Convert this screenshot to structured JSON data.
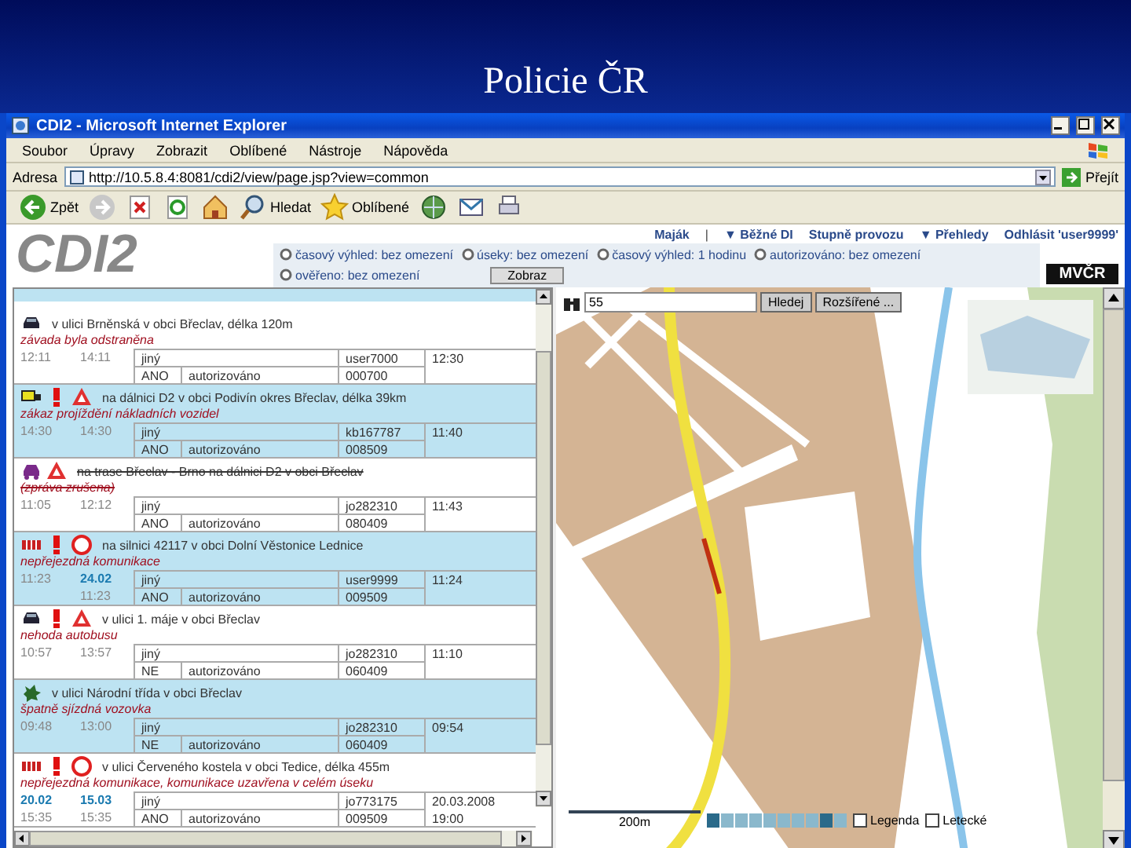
{
  "slide": {
    "title": "Policie ČR"
  },
  "window": {
    "title": "CDI2 - Microsoft Internet Explorer"
  },
  "menu": [
    "Soubor",
    "Úpravy",
    "Zobrazit",
    "Oblíbené",
    "Nástroje",
    "Nápověda"
  ],
  "address": {
    "label": "Adresa",
    "value": "http://10.5.8.4:8081/cdi2/view/page.jsp?view=common",
    "go": "Přejít"
  },
  "toolbar": [
    {
      "kind": "back",
      "label": "Zpět"
    },
    {
      "kind": "forward"
    },
    {
      "kind": "stop"
    },
    {
      "kind": "refresh"
    },
    {
      "kind": "home"
    },
    {
      "kind": "search",
      "label": "Hledat"
    },
    {
      "kind": "favorites",
      "label": "Oblíbené"
    },
    {
      "kind": "media"
    },
    {
      "kind": "mail"
    },
    {
      "kind": "print"
    }
  ],
  "app": {
    "logo": "CDI2",
    "nav": [
      {
        "kind": "link",
        "label": "Maják"
      },
      {
        "kind": "sep",
        "label": "|"
      },
      {
        "kind": "link",
        "label": "▼ Běžné DI"
      },
      {
        "kind": "link",
        "label": "Stupně provozu"
      },
      {
        "kind": "link",
        "label": "▼ Přehledy"
      },
      {
        "kind": "link",
        "label": "Odhlásit 'user9999'"
      }
    ],
    "filters": [
      {
        "label": "časový výhled: bez omezení"
      },
      {
        "label": "úseky: bez omezení"
      },
      {
        "label": "časový výhled: 1 hodinu"
      },
      {
        "label": "autorizováno: bez omezení"
      },
      {
        "label": "ověřeno: bez omezení"
      }
    ],
    "filter_button": "Zobraz",
    "badge": "MVČR"
  },
  "events": [
    {
      "icons": [
        {
          "kind": "car"
        }
      ],
      "location": "v ulici Brněnská v obci Břeclav, délka 120m",
      "note": "závada byla odstraněna",
      "cancelled": false,
      "start": {
        "time": "12:11"
      },
      "end": {
        "time": "14:11"
      },
      "type": "jiný",
      "author": "user7000",
      "reported": {
        "time": "12:30"
      },
      "verified": "ANO",
      "status": "autorizováno",
      "code": "000700"
    },
    {
      "icons": [
        {
          "kind": "truck"
        },
        {
          "kind": "exclamation"
        },
        {
          "kind": "triangle"
        }
      ],
      "location": "na dálnici D2 v obci Podivín okres Břeclav, délka 39km",
      "note": "zákaz projíždění nákladních vozidel",
      "cancelled": false,
      "start": {
        "time": "14:30"
      },
      "end": {
        "time": "14:30"
      },
      "type": "jiný",
      "author": "kb167787",
      "reported": {
        "time": "11:40"
      },
      "verified": "ANO",
      "status": "autorizováno",
      "code": "008509"
    },
    {
      "icons": [
        {
          "kind": "jam"
        },
        {
          "kind": "triangle"
        }
      ],
      "location": "na trase Břeclav - Brno na dálnici D2 v obci Břeclav",
      "note": "(zpráva zrušena)",
      "cancelled": true,
      "start": {
        "time": "11:05"
      },
      "end": {
        "time": "12:12"
      },
      "type": "jiný",
      "author": "jo282310",
      "reported": {
        "time": "11:43"
      },
      "verified": "ANO",
      "status": "autorizováno",
      "code": "080409"
    },
    {
      "icons": [
        {
          "kind": "barrier"
        },
        {
          "kind": "exclamation"
        },
        {
          "kind": "circle"
        }
      ],
      "location": "na silnici 42117 v obci Dolní Věstonice Lednice",
      "note": "nepřejezdná komunikace",
      "cancelled": false,
      "start": {
        "time": "11:23"
      },
      "end": {
        "date": "24.02",
        "time": "11:23"
      },
      "type": "jiný",
      "author": "user9999",
      "reported": {
        "time": "11:24"
      },
      "verified": "ANO",
      "status": "autorizováno",
      "code": "009509"
    },
    {
      "icons": [
        {
          "kind": "car"
        },
        {
          "kind": "exclamation"
        },
        {
          "kind": "triangle"
        }
      ],
      "location": "v ulici 1. máje v obci Břeclav",
      "note": "nehoda autobusu",
      "cancelled": false,
      "start": {
        "time": "10:57"
      },
      "end": {
        "time": "13:57"
      },
      "type": "jiný",
      "author": "jo282310",
      "reported": {
        "time": "11:10"
      },
      "verified": "NE",
      "status": "autorizováno",
      "code": "060409"
    },
    {
      "icons": [
        {
          "kind": "splat"
        }
      ],
      "location": "v ulici Národní třída v obci Břeclav",
      "note": "špatně sjízdná vozovka",
      "cancelled": false,
      "start": {
        "time": "09:48"
      },
      "end": {
        "time": "13:00"
      },
      "type": "jiný",
      "author": "jo282310",
      "reported": {
        "time": "09:54"
      },
      "verified": "NE",
      "status": "autorizováno",
      "code": "060409"
    },
    {
      "icons": [
        {
          "kind": "barrier"
        },
        {
          "kind": "exclamation"
        },
        {
          "kind": "circle"
        }
      ],
      "location": "v ulici Červeného kostela v obci Tedice, délka 455m",
      "note": "nepřejezdná komunikace, komunikace uzavřena v celém úseku",
      "cancelled": false,
      "start": {
        "date": "20.02",
        "time": "15:35"
      },
      "end": {
        "date": "15.03",
        "time": "15:35"
      },
      "type": "jiný",
      "author": "jo773175",
      "reported": {
        "date": "20.03.2008",
        "time": "19:00"
      },
      "verified": "ANO",
      "status": "autorizováno",
      "code": "009509"
    }
  ],
  "map": {
    "search": {
      "value": "55"
    },
    "buttons": [
      "Hledej",
      "Rozšířené ..."
    ],
    "scale": "200m",
    "zoom": {
      "level": 0.875
    },
    "options": [
      {
        "label": "Legenda",
        "checked": false
      },
      {
        "label": "Letecké",
        "checked": false
      }
    ]
  }
}
